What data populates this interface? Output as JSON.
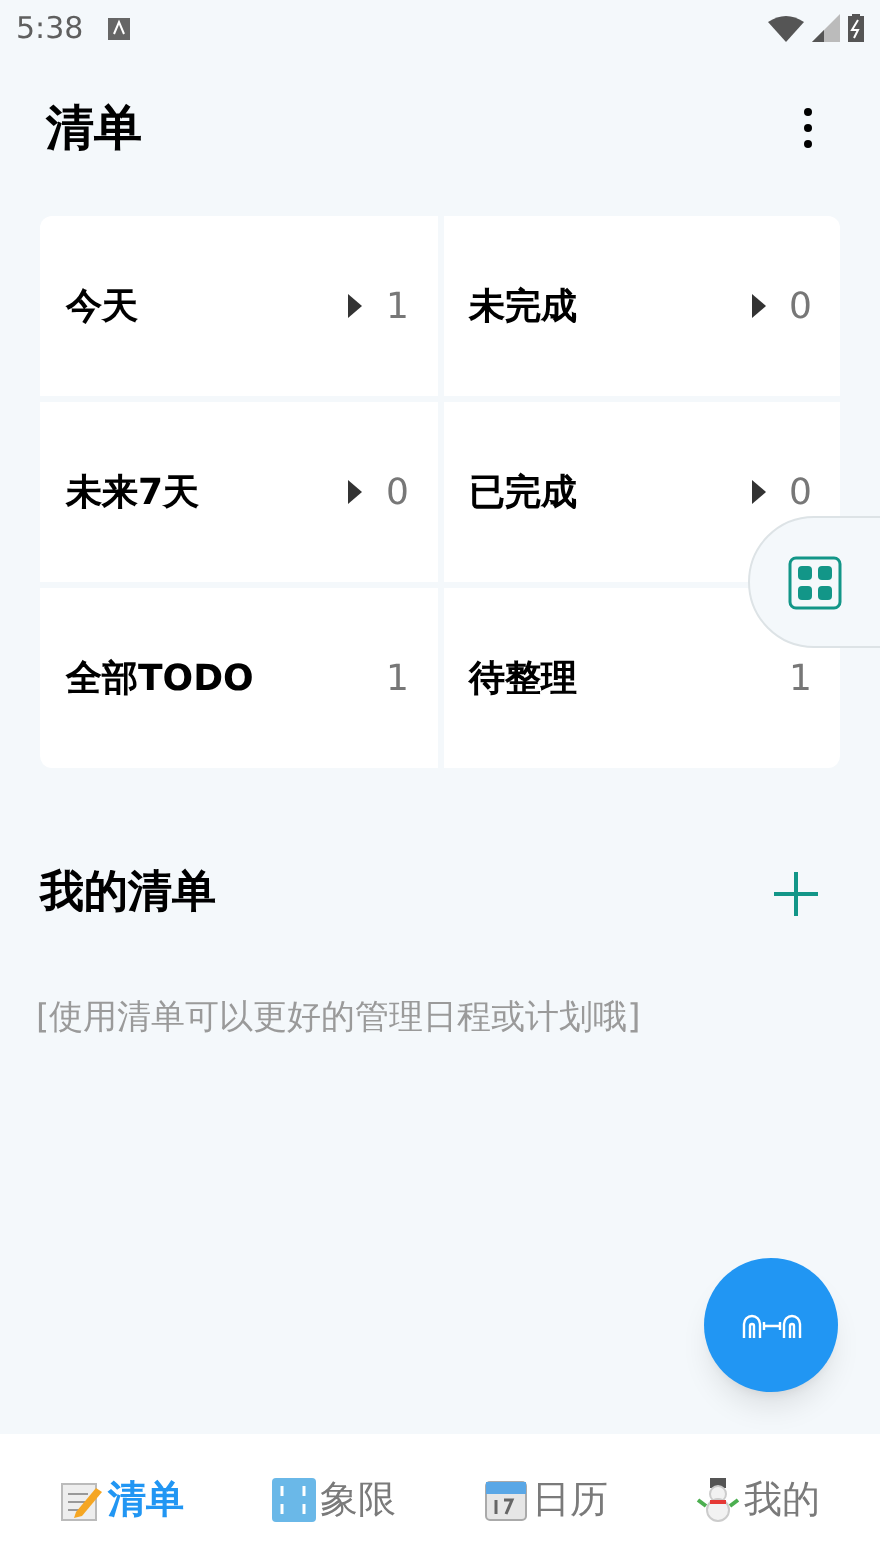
{
  "status_bar": {
    "time": "5:38"
  },
  "header": {
    "title": "清单"
  },
  "tiles": [
    {
      "label": "今天",
      "count": "1",
      "arrow": true
    },
    {
      "label": "未完成",
      "count": "0",
      "arrow": true
    },
    {
      "label": "未来7天",
      "count": "0",
      "arrow": true
    },
    {
      "label": "已完成",
      "count": "0",
      "arrow": true
    },
    {
      "label": "全部TODO",
      "count": "1",
      "arrow": false
    },
    {
      "label": "待整理",
      "count": "1",
      "arrow": false
    }
  ],
  "my_lists": {
    "title": "我的清单",
    "empty_hint": "[使用清单可以更好的管理日程或计划哦]"
  },
  "bottom_nav": [
    {
      "label": "清单",
      "selected": true
    },
    {
      "label": "象限",
      "selected": false
    },
    {
      "label": "日历",
      "selected": false
    },
    {
      "label": "我的",
      "selected": false
    }
  ]
}
